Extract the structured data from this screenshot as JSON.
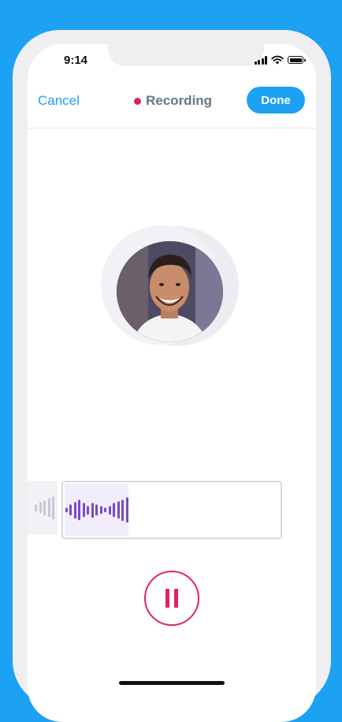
{
  "status_bar": {
    "time": "9:14",
    "icons": [
      "signal-icon",
      "wifi-icon",
      "battery-icon"
    ]
  },
  "navbar": {
    "cancel_label": "Cancel",
    "title": "Recording",
    "done_label": "Done"
  },
  "avatar": {
    "icon": "profile-photo"
  },
  "waveform": {
    "previous_clip_levels": [
      0.25,
      0.4,
      0.55,
      0.7,
      0.85
    ],
    "current_clip_levels": [
      0.2,
      0.45,
      0.65,
      0.8,
      0.55,
      0.35,
      0.6,
      0.45,
      0.3,
      0.2,
      0.35,
      0.55,
      0.7,
      0.85,
      1.0
    ]
  },
  "controls": {
    "pause_icon": "pause-icon"
  },
  "colors": {
    "accent": "#1DA1F2",
    "recording": "#E0245E",
    "waveform": "#794BC4",
    "title_gray": "#657786"
  }
}
